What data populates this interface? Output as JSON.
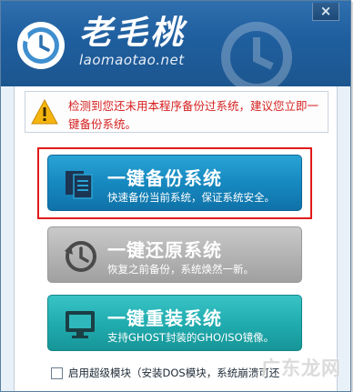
{
  "window": {
    "close_label": "×"
  },
  "brand": {
    "title": "老毛桃",
    "url": "laomaotao.net"
  },
  "notice": {
    "text": "检测到您还未用本程序备份过系统，建议您立即一键备份系统。"
  },
  "buttons": [
    {
      "title": "一键备份系统",
      "subtitle": "快速备份当前系统，保证系统安全。",
      "icon": "documents-icon"
    },
    {
      "title": "一键还原系统",
      "subtitle": "恢复之前备份，系统焕然一新。",
      "icon": "clock-restore-icon"
    },
    {
      "title": "一键重装系统",
      "subtitle": "支持GHOST封装的GHO/ISO镜像。",
      "icon": "monitor-icon"
    }
  ],
  "footer": {
    "checkbox_label": "启用超级模块（安装DOS模块，系统崩溃可还"
  },
  "watermark": {
    "text": "广东龙网"
  },
  "colors": {
    "header": "#1f5e9e",
    "backup": "#1689c0",
    "restore": "#b4b4b4",
    "reinstall": "#21adb0",
    "notice_text": "#d61f1f",
    "highlight": "#e11b1b"
  }
}
